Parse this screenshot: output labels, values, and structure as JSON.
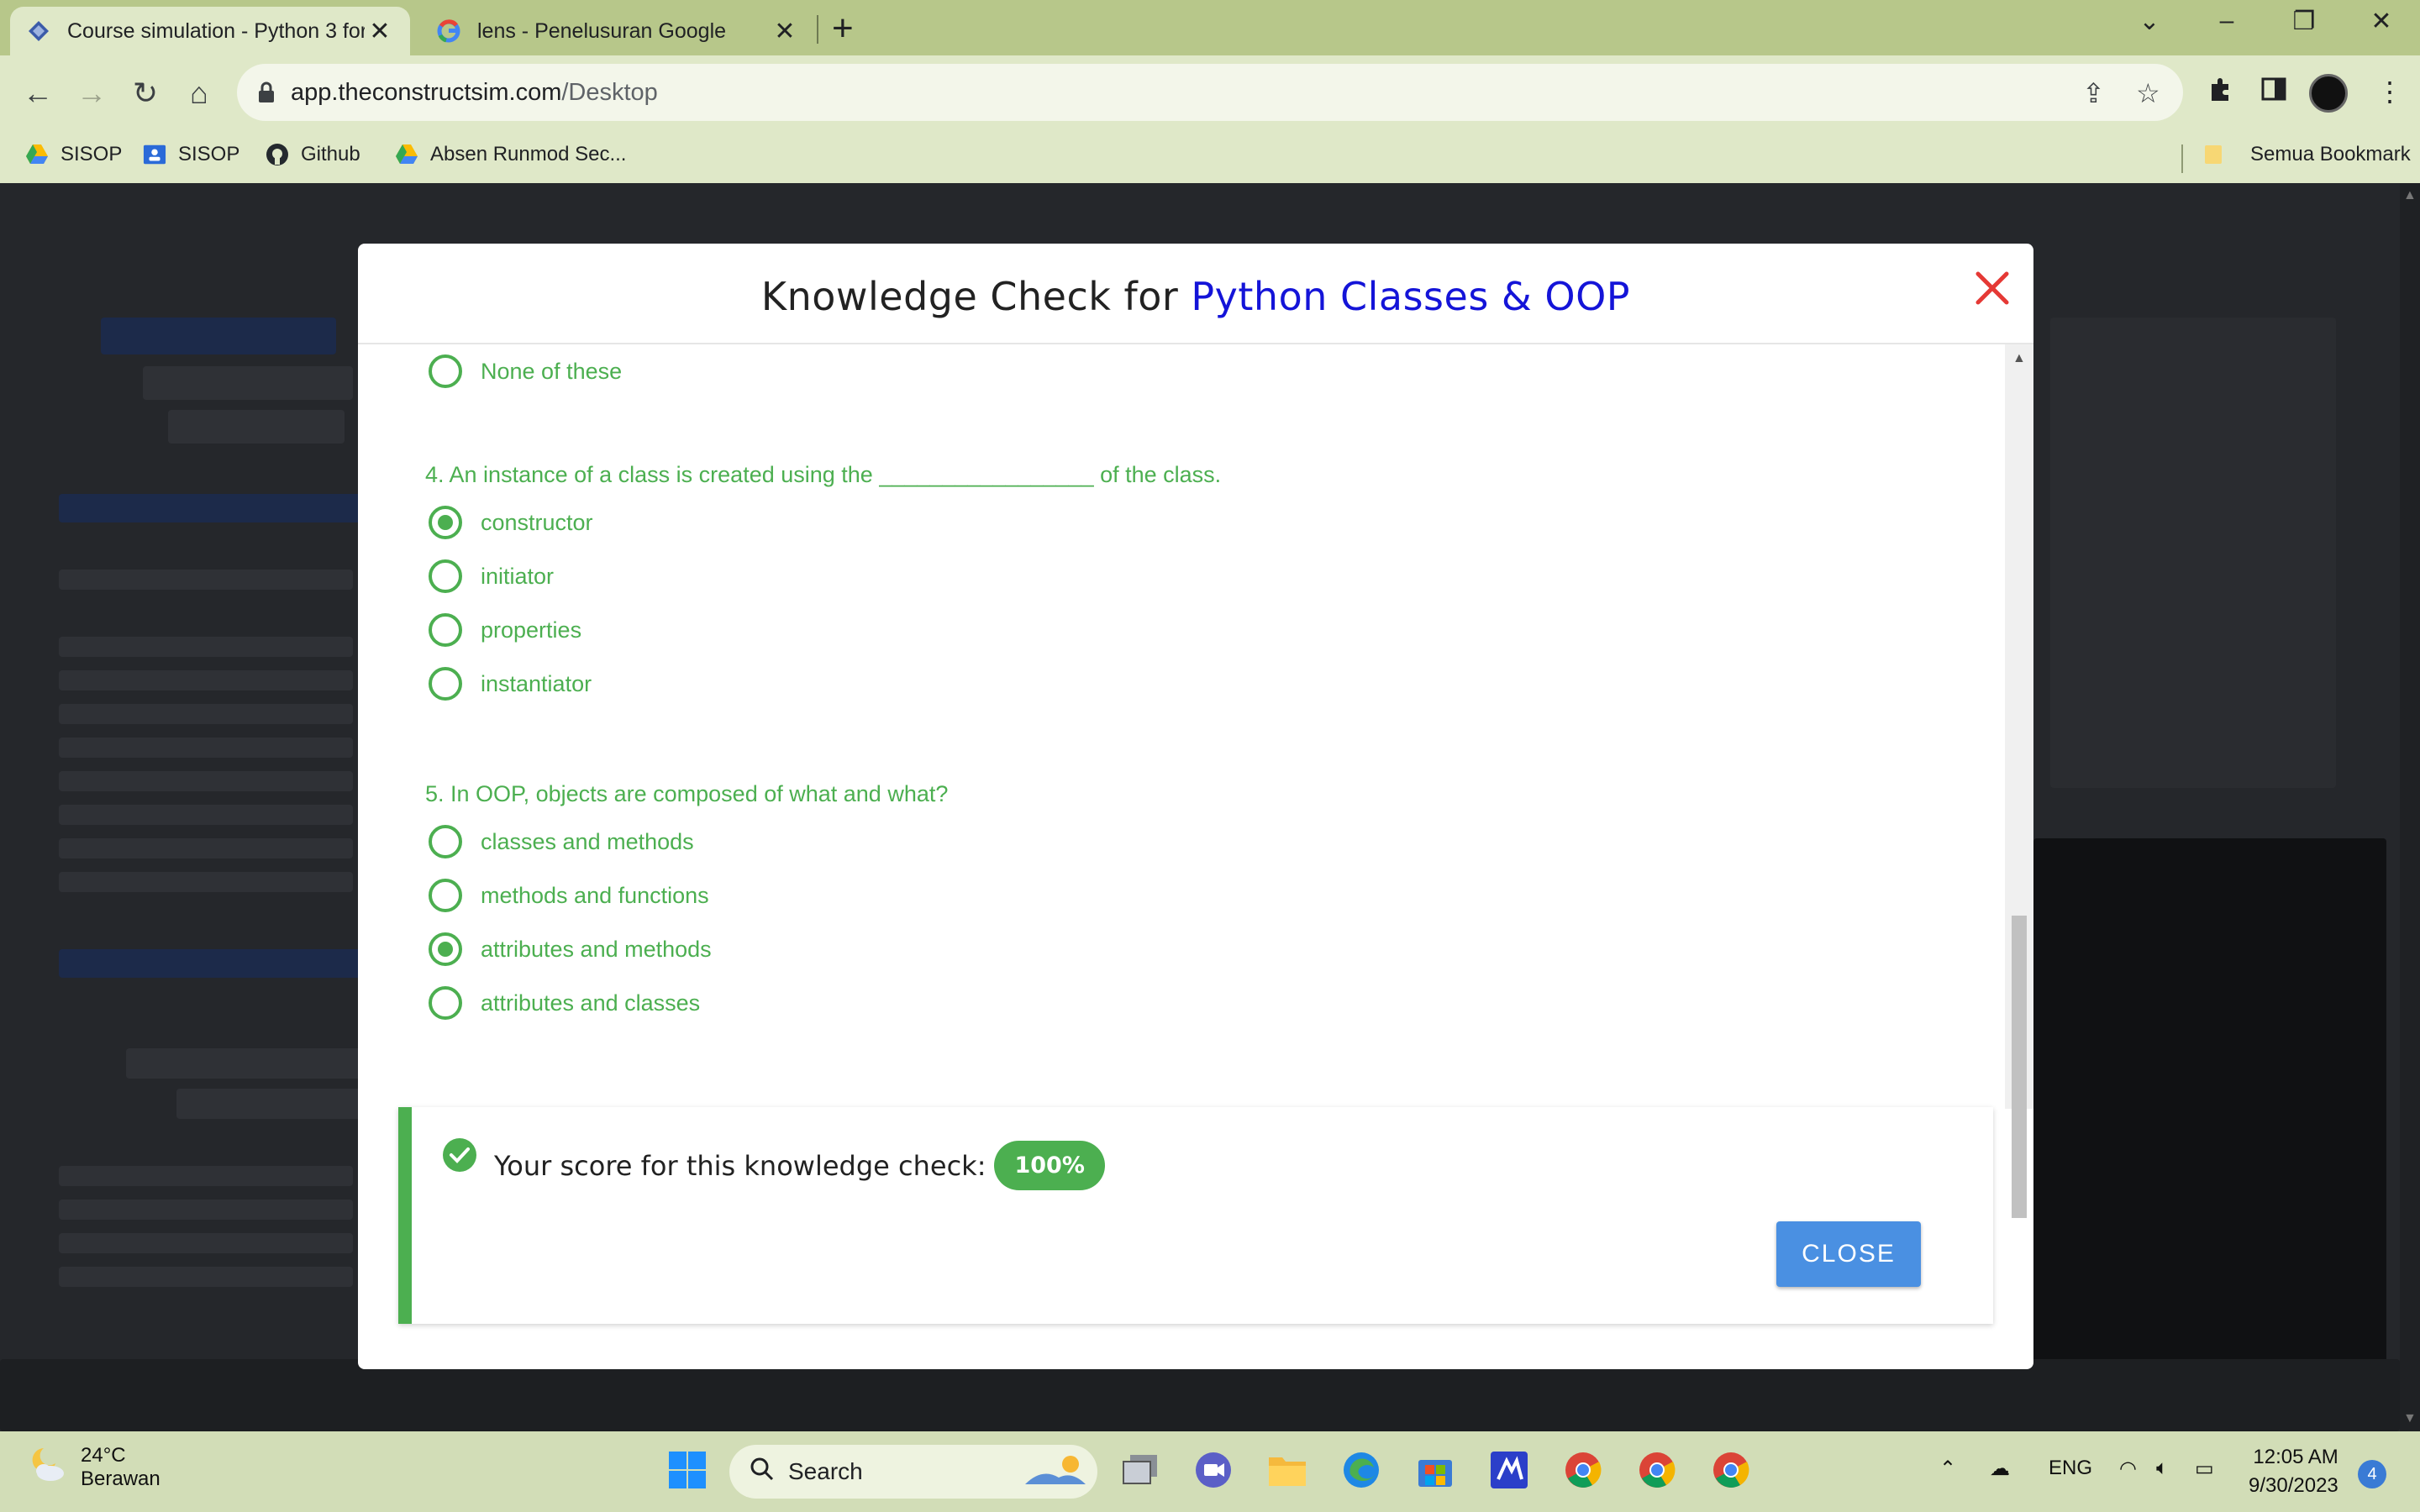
{
  "browser": {
    "tabs": [
      {
        "title": "Course simulation - Python 3 for",
        "icon": "constructsim-icon",
        "active": true
      },
      {
        "title": "lens - Penelusuran Google",
        "icon": "google-icon",
        "active": false
      }
    ],
    "url_host": "app.theconstructsim.com",
    "url_path": "/Desktop",
    "bookmarks": [
      {
        "label": "SISOP",
        "icon": "google-drive-icon"
      },
      {
        "label": "SISOP",
        "icon": "google-classroom-icon"
      },
      {
        "label": "Github",
        "icon": "github-icon"
      },
      {
        "label": "Absen Runmod Sec...",
        "icon": "google-drive-icon"
      }
    ],
    "all_bookmarks_label": "Semua Bookmark"
  },
  "modal": {
    "title_prefix": "Knowledge Check for ",
    "title_highlight": "Python Classes & OOP",
    "prev_option": "None of these",
    "questions": [
      {
        "text": "4. An instance of a class is created using the _________________ of the class.",
        "options": [
          {
            "label": "constructor",
            "selected": true
          },
          {
            "label": "initiator",
            "selected": false
          },
          {
            "label": "properties",
            "selected": false
          },
          {
            "label": "instantiator",
            "selected": false
          }
        ]
      },
      {
        "text": "5. In OOP, objects are composed of what and what?",
        "options": [
          {
            "label": "classes and methods",
            "selected": false
          },
          {
            "label": "methods and functions",
            "selected": false
          },
          {
            "label": "attributes and methods",
            "selected": true
          },
          {
            "label": "attributes and classes",
            "selected": false
          }
        ]
      }
    ],
    "score_label": "Your score for this knowledge check:",
    "score_value": "100%",
    "close_label": "CLOSE"
  },
  "taskbar": {
    "temperature": "24°C",
    "weather": "Berawan",
    "search_placeholder": "Search",
    "language": "ENG",
    "time": "12:05 AM",
    "date": "9/30/2023",
    "notifications": "4"
  },
  "colors": {
    "accent_green": "#4caf50",
    "title_blue": "#1414d8",
    "close_red": "#e53935",
    "button_blue": "#4a90e2"
  }
}
